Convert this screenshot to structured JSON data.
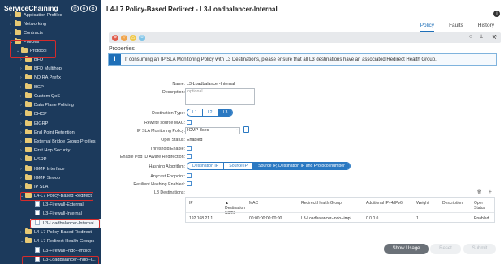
{
  "sidebar": {
    "title": "ServiceChaining",
    "header_icons": [
      "Ⓡ",
      "⊕",
      "⊗"
    ],
    "tree": [
      {
        "label": "Application Profiles",
        "icon": "folder-icon",
        "level": 1,
        "toggle": ">"
      },
      {
        "label": "Networking",
        "icon": "folder-icon",
        "level": 1,
        "toggle": ">"
      },
      {
        "label": "Contracts",
        "icon": "folder-icon",
        "level": 1,
        "toggle": ">"
      },
      {
        "label": "Policies",
        "icon": "folder-icon",
        "level": 1,
        "toggle": "v"
      },
      {
        "label": "Protocol",
        "icon": "folder-icon",
        "level": 2,
        "toggle": "v"
      },
      {
        "label": "BFD",
        "icon": "folder-icon",
        "level": 3,
        "toggle": ">"
      },
      {
        "label": "BFD Multihop",
        "icon": "folder-icon",
        "level": 3,
        "toggle": ">"
      },
      {
        "label": "ND RA Prefix",
        "icon": "folder-icon",
        "level": 3,
        "toggle": ">"
      },
      {
        "label": "BGP",
        "icon": "folder-icon",
        "level": 3,
        "toggle": ">"
      },
      {
        "label": "Custom QoS",
        "icon": "folder-icon",
        "level": 3,
        "toggle": ">"
      },
      {
        "label": "Data Plane Policing",
        "icon": "folder-icon",
        "level": 3,
        "toggle": ">"
      },
      {
        "label": "DHCP",
        "icon": "folder-icon",
        "level": 3,
        "toggle": ">"
      },
      {
        "label": "EIGRP",
        "icon": "folder-icon",
        "level": 3,
        "toggle": ">"
      },
      {
        "label": "End Point Retention",
        "icon": "folder-icon",
        "level": 3,
        "toggle": ">"
      },
      {
        "label": "External Bridge Group Profiles",
        "icon": "folder-icon",
        "level": 3,
        "toggle": ">"
      },
      {
        "label": "First Hop Security",
        "icon": "folder-icon",
        "level": 3,
        "toggle": ">"
      },
      {
        "label": "HSRP",
        "icon": "folder-icon",
        "level": 3,
        "toggle": ">"
      },
      {
        "label": "IGMP Interface",
        "icon": "folder-icon",
        "level": 3,
        "toggle": ">"
      },
      {
        "label": "IGMP Snoop",
        "icon": "folder-icon",
        "level": 3,
        "toggle": ">"
      },
      {
        "label": "IP SLA",
        "icon": "folder-icon",
        "level": 3,
        "toggle": ">"
      },
      {
        "label": "L4-L7 Policy-Based Redirect",
        "icon": "folder-icon",
        "level": 3,
        "toggle": "v"
      },
      {
        "label": "L3-Firewall-External",
        "icon": "document-icon",
        "level": 4,
        "toggle": ""
      },
      {
        "label": "L3-Firewall-Internal",
        "icon": "document-icon",
        "level": 4,
        "toggle": ""
      },
      {
        "label": "L3-Loadbalancer-Internal",
        "icon": "document-icon",
        "level": 4,
        "toggle": "",
        "selected": true
      },
      {
        "label": "L4-L7 Policy-Based Redirect",
        "icon": "folder-icon",
        "level": 3,
        "toggle": ">"
      },
      {
        "label": "L4-L7 Redirect Health Groups",
        "icon": "folder-icon",
        "level": 3,
        "toggle": "v"
      },
      {
        "label": "L3-Firewall--ndo--implct",
        "icon": "document-icon",
        "level": 4,
        "toggle": ""
      },
      {
        "label": "L3-Loadbalancer--ndo--i...",
        "icon": "document-icon",
        "level": 4,
        "toggle": ""
      }
    ]
  },
  "main": {
    "title": "L4-L7 Policy-Based Redirect - L3-Loadbalancer-Internal",
    "info_icon": "i",
    "tabs": [
      {
        "label": "Policy",
        "active": true
      },
      {
        "label": "Faults",
        "active": false
      },
      {
        "label": "History",
        "active": false
      }
    ],
    "toolbar": {
      "status_icons": [
        "⊗",
        "▽",
        "△",
        "①"
      ],
      "status_colors": [
        "#e05b4b",
        "#f0a34a",
        "#f0c84a",
        "#7fc4e8"
      ],
      "right_icons": [
        "○",
        "±",
        "⚒"
      ]
    },
    "properties_title": "Properties",
    "alert": {
      "icon": "i",
      "text": "If consuming an IP SLA Monitoring Policy with L3 Destinations, please ensure that all L3 destinations have an associated Redirect Health Group."
    },
    "form": {
      "name_label": "Name:",
      "name_value": "L3-Loadbalancer-Internal",
      "description_label": "Description:",
      "description_placeholder": "optional",
      "destination_type_label": "Destination Type:",
      "destination_type_options": [
        "L1",
        "L2",
        "L3"
      ],
      "destination_type_selected": "L3",
      "rewrite_mac_label": "Rewrite source MAC:",
      "ipsla_label": "IP SLA Monitoring Policy:",
      "ipsla_value": "ICMP-3sec",
      "oper_status_label": "Oper Status:",
      "oper_status_value": "Enabled",
      "threshold_label": "Threshold Enable:",
      "pod_aware_label": "Enable Pod ID Aware Redirection:",
      "hashing_label": "Hashing Algorithm:",
      "hashing_options": [
        "Destination IP",
        "Source IP",
        "Source IP, Destination IP and Protocol number"
      ],
      "hashing_selected": "Source IP, Destination IP and Protocol number",
      "anycast_label": "Anycast Endpoint:",
      "resilient_label": "Resilient Hashing Enabled:",
      "l3_dest_label": "L3 Destinations:"
    },
    "table": {
      "tools": [
        "🗑",
        "+"
      ],
      "columns": [
        "IP",
        "▲ Destination Name",
        "MAC",
        "Redirect Health Group",
        "Additional IPv4/IPv6",
        "Weight",
        "Description",
        "Oper Status"
      ],
      "rows": [
        [
          "192.168.21.1",
          "",
          "00:00:00:00:00:00",
          "L3-Loadbalancer--ndo--impl...",
          "0.0.0.0",
          "1",
          "",
          "Enabled"
        ]
      ]
    },
    "buttons": {
      "show_usage": "Show Usage",
      "reset": "Reset",
      "submit": "Submit"
    }
  }
}
